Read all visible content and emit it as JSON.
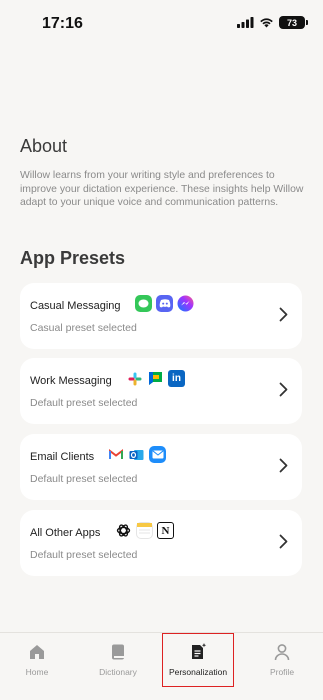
{
  "status_bar": {
    "time": "17:16",
    "battery": "73"
  },
  "about": {
    "title": "About",
    "body": "Willow learns from your writing style and preferences to improve your dictation experience. These insights help Willow adapt to your unique voice and communication patterns."
  },
  "presets": {
    "title": "App Presets",
    "items": [
      {
        "name": "Casual Messaging",
        "status": "Casual preset selected",
        "icons": [
          "messages-icon",
          "discord-icon",
          "messenger-icon"
        ]
      },
      {
        "name": "Work Messaging",
        "status": "Default preset selected",
        "icons": [
          "slack-icon",
          "google-chat-icon",
          "linkedin-icon"
        ]
      },
      {
        "name": "Email Clients",
        "status": "Default preset selected",
        "icons": [
          "gmail-icon",
          "outlook-icon",
          "apple-mail-icon"
        ]
      },
      {
        "name": "All Other Apps",
        "status": "Default preset selected",
        "icons": [
          "chatgpt-icon",
          "notes-icon",
          "notion-icon"
        ]
      }
    ]
  },
  "tabs": {
    "home": "Home",
    "dictionary": "Dictionary",
    "personalization": "Personalization",
    "profile": "Profile",
    "active": "personalization"
  },
  "colors": {
    "background": "#f7f6f4",
    "card": "#ffffff",
    "highlight": "#dd2222"
  }
}
